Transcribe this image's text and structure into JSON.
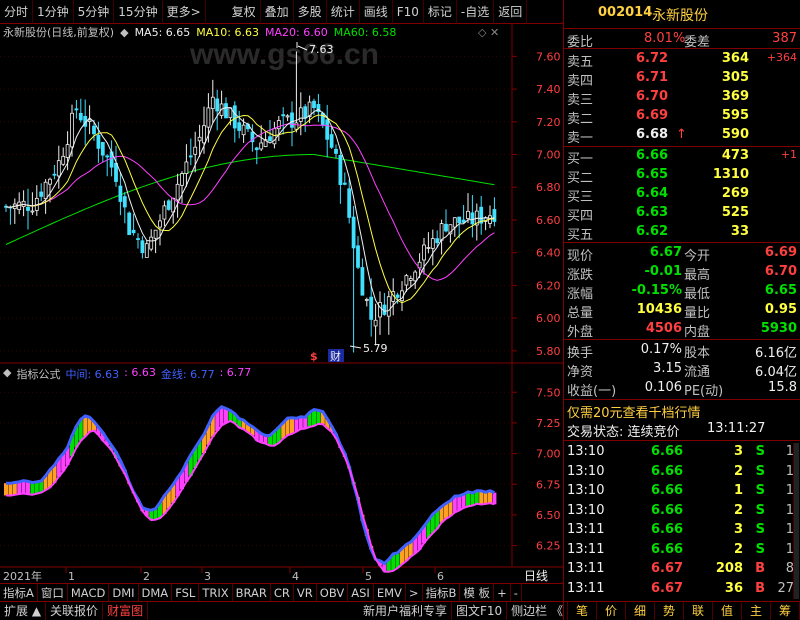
{
  "toolbar": {
    "left_items": [
      "分时",
      "1分钟",
      "5分钟",
      "15分钟",
      "更多>"
    ],
    "right_items": [
      "复权",
      "叠加",
      "多股",
      "统计",
      "画线",
      "F10",
      "标记",
      "-自选",
      "返回"
    ]
  },
  "chart_header": {
    "stock_label": "永新股份(日线,前复权)",
    "ma5": "MA5: 6.65",
    "ma10": "MA10: 6.63",
    "ma20": "MA20: 6.60",
    "ma60": "MA60: 6.58",
    "watermark": "www.gs66.cn",
    "high_mark": "7.63",
    "low_mark": "5.79",
    "tag1": "$",
    "tag2": "财"
  },
  "indicator_header": {
    "title": "指标公式",
    "mid_label": "中间: 6.63",
    "mid_val2": ": 6.63",
    "gold_label": "金线: 6.77",
    "gold_val2": ": 6.77"
  },
  "time_axis": {
    "year": "2021年",
    "months": [
      "1",
      "2",
      "3",
      "4",
      "5",
      "6"
    ],
    "period": "日线"
  },
  "chart_data": [
    {
      "type": "candlestick",
      "title": "永新股份(日线,前复权)",
      "y_ticks": [
        "7.60",
        "7.40",
        "7.20",
        "7.00",
        "6.80",
        "6.60",
        "6.40",
        "6.20",
        "6.00",
        "5.80"
      ],
      "ylim": [
        5.75,
        7.7
      ],
      "annotations": [
        {
          "label": "7.63",
          "type": "high"
        },
        {
          "label": "5.79",
          "type": "low"
        }
      ],
      "series": [
        {
          "name": "MA5",
          "value": 6.65,
          "color": "#f0f0f0"
        },
        {
          "name": "MA10",
          "value": 6.63,
          "color": "#ffff40"
        },
        {
          "name": "MA20",
          "value": 6.6,
          "color": "#ff40ff"
        },
        {
          "name": "MA60",
          "value": 6.58,
          "color": "#00e000"
        }
      ]
    },
    {
      "type": "line",
      "title": "指标公式",
      "y_ticks": [
        "7.50",
        "7.25",
        "7.00",
        "6.75",
        "6.50",
        "6.25"
      ],
      "ylim": [
        6.1,
        7.6
      ],
      "series": [
        {
          "name": "中间",
          "value": 6.63,
          "color": "#4060ff"
        },
        {
          "name": "金线",
          "value": 6.77,
          "color": "#ff40ff"
        }
      ]
    }
  ],
  "bottom_tabs": [
    "指标A",
    "窗口",
    "MACD",
    "DMI",
    "DMA",
    "FSL",
    "TRIX",
    "BRAR",
    "CR",
    "VR",
    "OBV",
    "ASI",
    "EMV",
    ">",
    "指标B",
    "模 板",
    "+",
    "-"
  ],
  "status_bar": {
    "left": [
      "扩展 ▲",
      "关联报价",
      "财富图"
    ],
    "mid": [
      "新用户福利专享",
      "图文F10",
      "侧边栏 《"
    ],
    "right_tabs": [
      "笔",
      "价",
      "细",
      "势",
      "联",
      "值",
      "主",
      "筹"
    ]
  },
  "quote": {
    "code": "002014",
    "name": "永新股份",
    "weibi_label": "委比",
    "weibi": "8.01%",
    "weicha_label": "委差",
    "weicha": "387",
    "sells": [
      {
        "label": "卖五",
        "price": "6.72",
        "vol": "364",
        "chg": "+364"
      },
      {
        "label": "卖四",
        "price": "6.71",
        "vol": "305",
        "chg": ""
      },
      {
        "label": "卖三",
        "price": "6.70",
        "vol": "369",
        "chg": ""
      },
      {
        "label": "卖二",
        "price": "6.69",
        "vol": "595",
        "chg": ""
      },
      {
        "label": "卖一",
        "price": "6.68",
        "vol": "590",
        "chg": ""
      }
    ],
    "buys": [
      {
        "label": "买一",
        "price": "6.66",
        "vol": "473",
        "chg": "+1"
      },
      {
        "label": "买二",
        "price": "6.65",
        "vol": "1310",
        "chg": ""
      },
      {
        "label": "买三",
        "price": "6.64",
        "vol": "269",
        "chg": ""
      },
      {
        "label": "买四",
        "price": "6.63",
        "vol": "525",
        "chg": ""
      },
      {
        "label": "买五",
        "price": "6.62",
        "vol": "33",
        "chg": ""
      }
    ],
    "stats": [
      {
        "l1": "现价",
        "v1": "6.67",
        "l2": "今开",
        "v2": "6.69"
      },
      {
        "l1": "涨跌",
        "v1": "-0.01",
        "l2": "最高",
        "v2": "6.70"
      },
      {
        "l1": "涨幅",
        "v1": "-0.15%",
        "l2": "最低",
        "v2": "6.65"
      },
      {
        "l1": "总量",
        "v1": "10436",
        "l2": "量比",
        "v2": "0.95"
      },
      {
        "l1": "外盘",
        "v1": "4506",
        "l2": "内盘",
        "v2": "5930"
      }
    ],
    "stats2": [
      {
        "l1": "换手",
        "v1": "0.17%",
        "l2": "股本",
        "v2": "6.16亿"
      },
      {
        "l1": "净资",
        "v1": "3.15",
        "l2": "流通",
        "v2": "6.04亿"
      },
      {
        "l1": "收益(一)",
        "v1": "0.106",
        "l2": "PE(动)",
        "v2": "15.8"
      }
    ],
    "promo": "仅需20元查看千档行情",
    "trade_status_label": "交易状态: 连续竞价",
    "trade_time": "13:11:27",
    "ticks": [
      {
        "time": "13:10",
        "price": "6.66",
        "vol": "3",
        "side": "S",
        "n": "1"
      },
      {
        "time": "13:10",
        "price": "6.66",
        "vol": "2",
        "side": "S",
        "n": "1"
      },
      {
        "time": "13:10",
        "price": "6.66",
        "vol": "1",
        "side": "S",
        "n": "1"
      },
      {
        "time": "13:10",
        "price": "6.66",
        "vol": "2",
        "side": "S",
        "n": "1"
      },
      {
        "time": "13:11",
        "price": "6.66",
        "vol": "3",
        "side": "S",
        "n": "1"
      },
      {
        "time": "13:11",
        "price": "6.66",
        "vol": "2",
        "side": "S",
        "n": "1"
      },
      {
        "time": "13:11",
        "price": "6.67",
        "vol": "208",
        "side": "B",
        "n": "8"
      },
      {
        "time": "13:11",
        "price": "6.67",
        "vol": "36",
        "side": "B",
        "n": "27"
      }
    ]
  }
}
